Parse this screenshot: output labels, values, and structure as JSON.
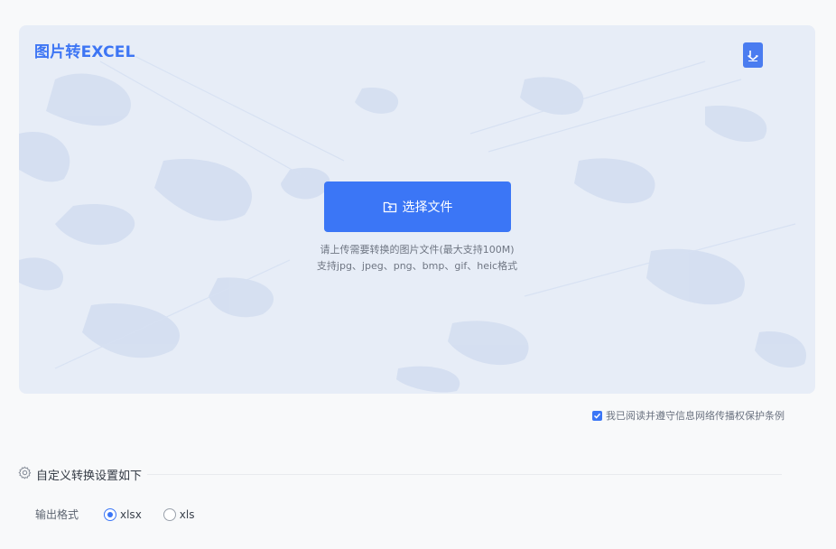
{
  "upload": {
    "title": "图片转EXCEL",
    "button_label": "选择文件",
    "hint_line_1": "请上传需要转换的图片文件(最大支持100M)",
    "hint_line_2": "支持jpg、jpeg、png、bmp、gif、heic格式"
  },
  "agreement": {
    "label": "我已阅读并遵守信息网络传播权保护条例",
    "checked": true
  },
  "settings": {
    "title": "自定义转换设置如下",
    "output_format_label": "输出格式",
    "options": [
      {
        "label": "xlsx",
        "checked": true
      },
      {
        "label": "xls",
        "checked": false
      }
    ]
  },
  "colors": {
    "accent": "#3b76f6",
    "panel_bg": "#e7edf7",
    "page_bg": "#f8f9fa"
  },
  "icons": [
    "download-icon",
    "folder-icon",
    "gear-icon",
    "checkbox-icon"
  ]
}
